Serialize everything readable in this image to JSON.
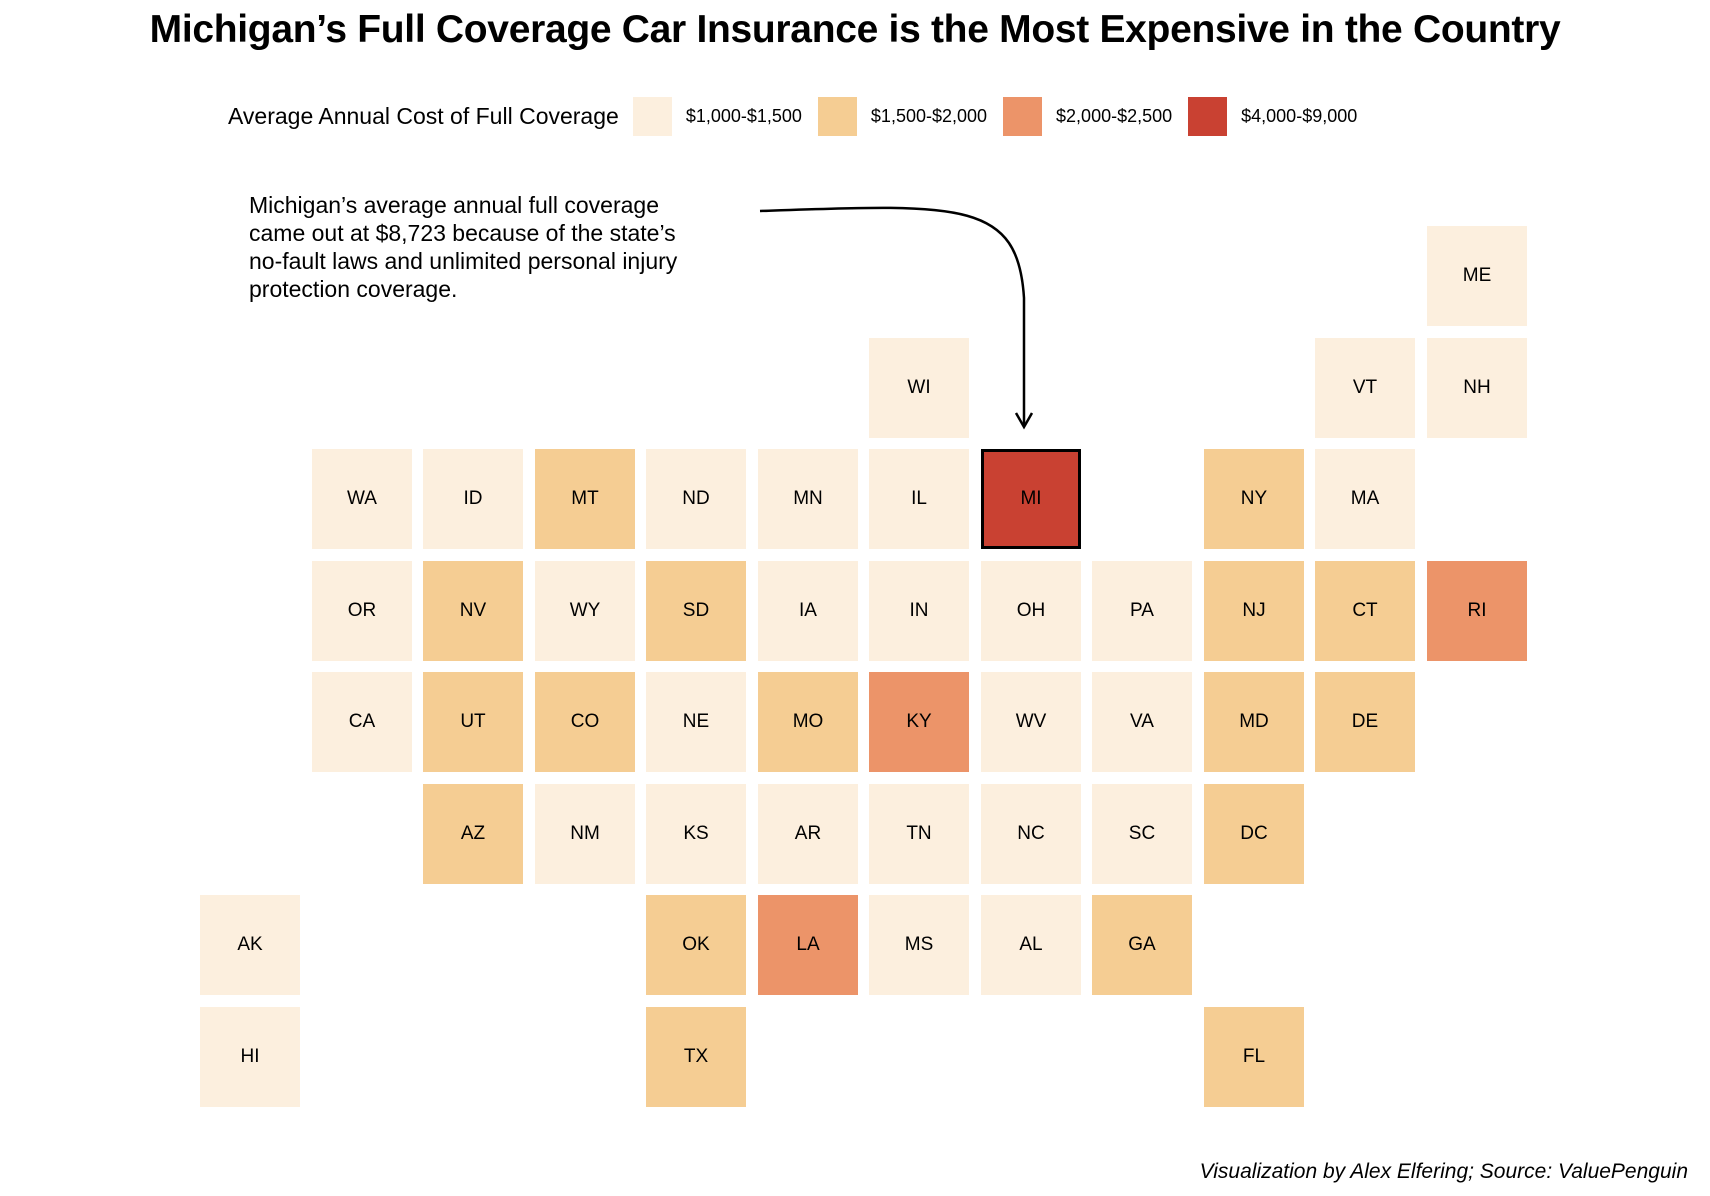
{
  "title": "Michigan’s Full Coverage Car Insurance is the Most Expensive in the Country",
  "legend": {
    "title": "Average Annual Cost of Full Coverage",
    "items": [
      {
        "label": "$1,000-$1,500",
        "color": "#fcefde"
      },
      {
        "label": "$1,500-$2,000",
        "color": "#f5cd93"
      },
      {
        "label": "$2,000-$2,500",
        "color": "#ec9469"
      },
      {
        "label": "$4,000-$9,000",
        "color": "#c94132"
      }
    ]
  },
  "annotation": {
    "lines": [
      "Michigan’s average annual full coverage",
      "came out at $8,723 because of the state’s",
      "no-fault laws and unlimited personal injury",
      "protection coverage."
    ]
  },
  "credit": "Visualization by Alex Elfering; Source: ValuePenguin",
  "chart_data": {
    "type": "heatmap",
    "title": "Michigan’s Full Coverage Car Insurance is the Most Expensive in the Country",
    "legend_title": "Average Annual Cost of Full Coverage",
    "legend_placement": "top",
    "categories": [
      "$1,000-$1,500",
      "$1,500-$2,000",
      "$2,000-$2,500",
      "$4,000-$9,000"
    ],
    "highlight": "MI",
    "states": [
      {
        "state": "ME",
        "col": 11,
        "row": 0,
        "category": "$1,000-$1,500"
      },
      {
        "state": "WI",
        "col": 6,
        "row": 1,
        "category": "$1,000-$1,500"
      },
      {
        "state": "VT",
        "col": 10,
        "row": 1,
        "category": "$1,000-$1,500"
      },
      {
        "state": "NH",
        "col": 11,
        "row": 1,
        "category": "$1,000-$1,500"
      },
      {
        "state": "WA",
        "col": 1,
        "row": 2,
        "category": "$1,000-$1,500"
      },
      {
        "state": "ID",
        "col": 2,
        "row": 2,
        "category": "$1,000-$1,500"
      },
      {
        "state": "MT",
        "col": 3,
        "row": 2,
        "category": "$1,500-$2,000"
      },
      {
        "state": "ND",
        "col": 4,
        "row": 2,
        "category": "$1,000-$1,500"
      },
      {
        "state": "MN",
        "col": 5,
        "row": 2,
        "category": "$1,000-$1,500"
      },
      {
        "state": "IL",
        "col": 6,
        "row": 2,
        "category": "$1,000-$1,500"
      },
      {
        "state": "MI",
        "col": 7,
        "row": 2,
        "category": "$4,000-$9,000"
      },
      {
        "state": "NY",
        "col": 9,
        "row": 2,
        "category": "$1,500-$2,000"
      },
      {
        "state": "MA",
        "col": 10,
        "row": 2,
        "category": "$1,000-$1,500"
      },
      {
        "state": "OR",
        "col": 1,
        "row": 3,
        "category": "$1,000-$1,500"
      },
      {
        "state": "NV",
        "col": 2,
        "row": 3,
        "category": "$1,500-$2,000"
      },
      {
        "state": "WY",
        "col": 3,
        "row": 3,
        "category": "$1,000-$1,500"
      },
      {
        "state": "SD",
        "col": 4,
        "row": 3,
        "category": "$1,500-$2,000"
      },
      {
        "state": "IA",
        "col": 5,
        "row": 3,
        "category": "$1,000-$1,500"
      },
      {
        "state": "IN",
        "col": 6,
        "row": 3,
        "category": "$1,000-$1,500"
      },
      {
        "state": "OH",
        "col": 7,
        "row": 3,
        "category": "$1,000-$1,500"
      },
      {
        "state": "PA",
        "col": 8,
        "row": 3,
        "category": "$1,000-$1,500"
      },
      {
        "state": "NJ",
        "col": 9,
        "row": 3,
        "category": "$1,500-$2,000"
      },
      {
        "state": "CT",
        "col": 10,
        "row": 3,
        "category": "$1,500-$2,000"
      },
      {
        "state": "RI",
        "col": 11,
        "row": 3,
        "category": "$2,000-$2,500"
      },
      {
        "state": "CA",
        "col": 1,
        "row": 4,
        "category": "$1,000-$1,500"
      },
      {
        "state": "UT",
        "col": 2,
        "row": 4,
        "category": "$1,500-$2,000"
      },
      {
        "state": "CO",
        "col": 3,
        "row": 4,
        "category": "$1,500-$2,000"
      },
      {
        "state": "NE",
        "col": 4,
        "row": 4,
        "category": "$1,000-$1,500"
      },
      {
        "state": "MO",
        "col": 5,
        "row": 4,
        "category": "$1,500-$2,000"
      },
      {
        "state": "KY",
        "col": 6,
        "row": 4,
        "category": "$2,000-$2,500"
      },
      {
        "state": "WV",
        "col": 7,
        "row": 4,
        "category": "$1,000-$1,500"
      },
      {
        "state": "VA",
        "col": 8,
        "row": 4,
        "category": "$1,000-$1,500"
      },
      {
        "state": "MD",
        "col": 9,
        "row": 4,
        "category": "$1,500-$2,000"
      },
      {
        "state": "DE",
        "col": 10,
        "row": 4,
        "category": "$1,500-$2,000"
      },
      {
        "state": "AZ",
        "col": 2,
        "row": 5,
        "category": "$1,500-$2,000"
      },
      {
        "state": "NM",
        "col": 3,
        "row": 5,
        "category": "$1,000-$1,500"
      },
      {
        "state": "KS",
        "col": 4,
        "row": 5,
        "category": "$1,000-$1,500"
      },
      {
        "state": "AR",
        "col": 5,
        "row": 5,
        "category": "$1,000-$1,500"
      },
      {
        "state": "TN",
        "col": 6,
        "row": 5,
        "category": "$1,000-$1,500"
      },
      {
        "state": "NC",
        "col": 7,
        "row": 5,
        "category": "$1,000-$1,500"
      },
      {
        "state": "SC",
        "col": 8,
        "row": 5,
        "category": "$1,000-$1,500"
      },
      {
        "state": "DC",
        "col": 9,
        "row": 5,
        "category": "$1,500-$2,000"
      },
      {
        "state": "AK",
        "col": 0,
        "row": 6,
        "category": "$1,000-$1,500"
      },
      {
        "state": "OK",
        "col": 4,
        "row": 6,
        "category": "$1,500-$2,000"
      },
      {
        "state": "LA",
        "col": 5,
        "row": 6,
        "category": "$2,000-$2,500"
      },
      {
        "state": "MS",
        "col": 6,
        "row": 6,
        "category": "$1,000-$1,500"
      },
      {
        "state": "AL",
        "col": 7,
        "row": 6,
        "category": "$1,000-$1,500"
      },
      {
        "state": "GA",
        "col": 8,
        "row": 6,
        "category": "$1,500-$2,000"
      },
      {
        "state": "HI",
        "col": 0,
        "row": 7,
        "category": "$1,000-$1,500"
      },
      {
        "state": "TX",
        "col": 4,
        "row": 7,
        "category": "$1,500-$2,000"
      },
      {
        "state": "FL",
        "col": 9,
        "row": 7,
        "category": "$1,500-$2,000"
      }
    ]
  }
}
